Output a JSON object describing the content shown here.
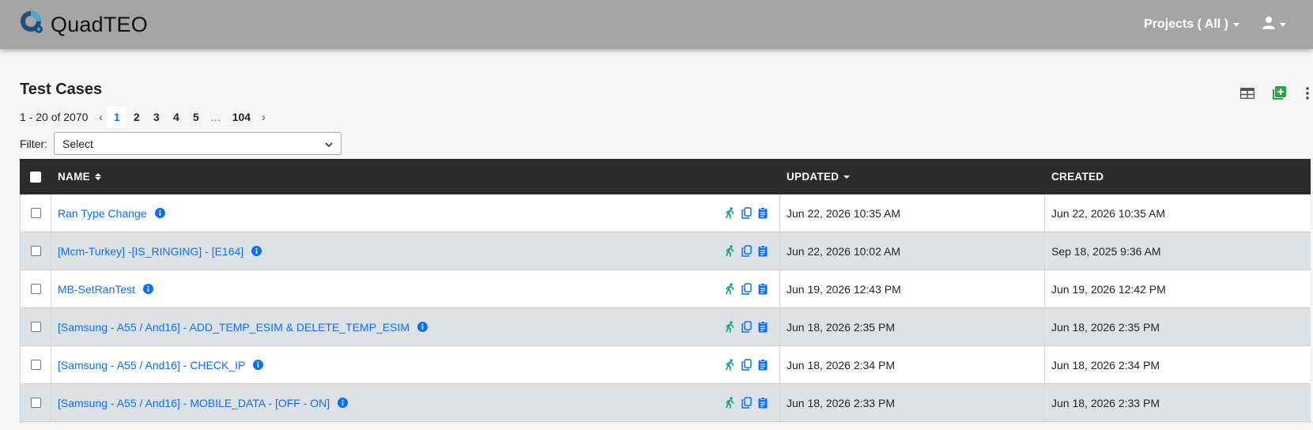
{
  "app": {
    "name": "QuadTEO"
  },
  "nav": {
    "projects_label": "Projects ( All )"
  },
  "page": {
    "title": "Test Cases"
  },
  "pagination": {
    "range": "1 - 20 of 2070",
    "pages": [
      "1",
      "2",
      "3",
      "4",
      "5",
      "…",
      "104"
    ],
    "current": "1"
  },
  "filter": {
    "label": "Filter:",
    "selected": "Select"
  },
  "table": {
    "headers": {
      "name": "NAME",
      "updated": "UPDATED",
      "created": "CREATED"
    },
    "rows": [
      {
        "name": "Ran Type Change",
        "updated": "Jun 22, 2026 10:35 AM",
        "created": "Jun 22, 2026 10:35 AM"
      },
      {
        "name": "[Mcm-Turkey] -[IS_RINGING] - [E164]",
        "updated": "Jun 22, 2026 10:02 AM",
        "created": "Sep 18, 2025 9:36 AM"
      },
      {
        "name": "MB-SetRanTest",
        "updated": "Jun 19, 2026 12:43 PM",
        "created": "Jun 19, 2026 12:42 PM"
      },
      {
        "name": "[Samsung - A55 / And16] - ADD_TEMP_ESIM & DELETE_TEMP_ESIM",
        "updated": "Jun 18, 2026 2:35 PM",
        "created": "Jun 18, 2026 2:35 PM"
      },
      {
        "name": "[Samsung - A55 / And16] - CHECK_IP",
        "updated": "Jun 18, 2026 2:34 PM",
        "created": "Jun 18, 2026 2:34 PM"
      },
      {
        "name": "[Samsung - A55 / And16] - MOBILE_DATA - [OFF - ON]",
        "updated": "Jun 18, 2026 2:33 PM",
        "created": "Jun 18, 2026 2:33 PM"
      }
    ]
  },
  "icons": {
    "row_actions": [
      "run-icon",
      "copy-icon",
      "clipboard-icon"
    ],
    "toolbar": [
      "table-view-icon",
      "add-icon",
      "more-vertical-icon"
    ]
  },
  "colors": {
    "navbar": "#a5a5a5",
    "link": "#0d6efd",
    "header": "#2b2b2b",
    "run": "#1a9c8c",
    "add": "#28a745"
  }
}
